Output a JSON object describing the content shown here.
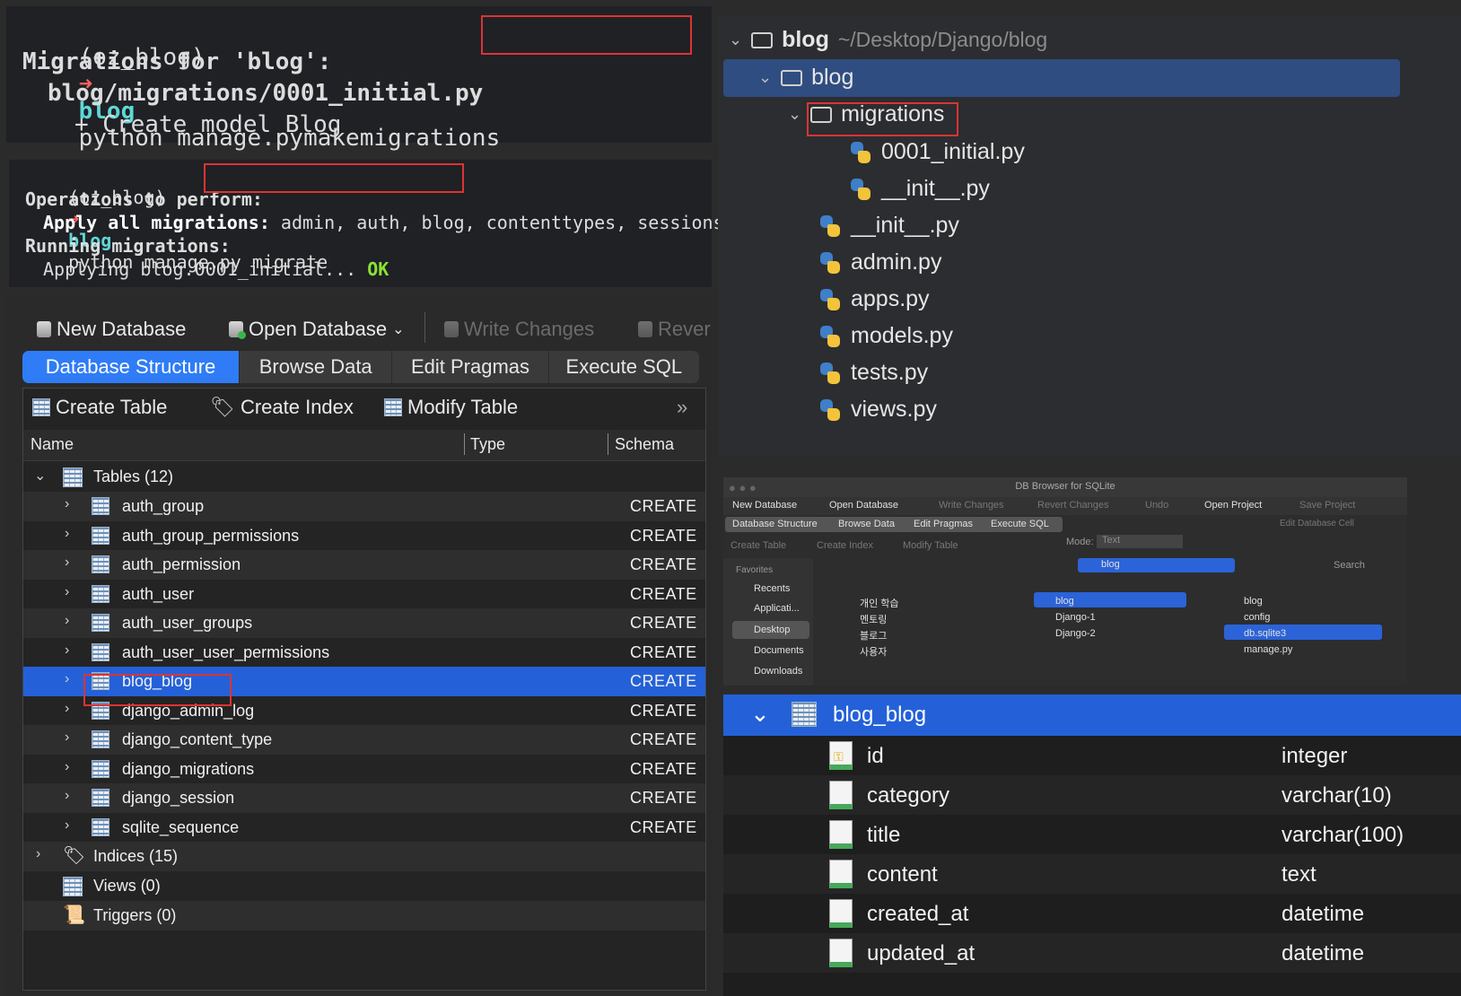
{
  "terminal1": {
    "line1_env": "(oz_blog)",
    "line1_arrow": "➜",
    "line1_dir": "blog",
    "line1_cmd": "python manage.py",
    "line1_sub": "makemigrations",
    "line2": "Migrations for 'blog':",
    "line3": "blog/migrations/0001_initial.py",
    "line4": "+ Create model Blog"
  },
  "terminal2": {
    "line1_env": "(oz_blog)",
    "line1_arrow": "➜",
    "line1_dir": "blog",
    "line1_cmd": "python manage.py migrate",
    "line2": "Operations to perform:",
    "line3_bold": "Apply all migrations:",
    "line3_rest": " admin, auth, blog, contenttypes, sessions",
    "line4": "Running migrations:",
    "line5": "Applying blog.0001_initial...",
    "line5_ok": "OK"
  },
  "toolbar": {
    "new_db": "New Database",
    "open_db": "Open Database",
    "write_changes": "Write Changes",
    "revert": "Rever"
  },
  "tabs": [
    "Database Structure",
    "Browse Data",
    "Edit Pragmas",
    "Execute SQL"
  ],
  "subtoolbar": {
    "create_table": "Create Table",
    "create_index": "Create Index",
    "modify_table": "Modify Table",
    "more": "»"
  },
  "columns": {
    "name": "Name",
    "type": "Type",
    "schema": "Schema"
  },
  "tables_header": "Tables (12)",
  "tables": [
    "auth_group",
    "auth_group_permissions",
    "auth_permission",
    "auth_user",
    "auth_user_groups",
    "auth_user_user_permissions",
    "blog_blog",
    "django_admin_log",
    "django_content_type",
    "django_migrations",
    "django_session",
    "sqlite_sequence"
  ],
  "schema_cell": "CREATE",
  "indices": "Indices (15)",
  "views": "Views (0)",
  "triggers": "Triggers (0)",
  "project": {
    "root_name": "blog",
    "root_path": "~/Desktop/Django/blog",
    "app": "blog",
    "migrations": "migrations",
    "migration_files": [
      "0001_initial.py",
      "__init__.py"
    ],
    "files": [
      "__init__.py",
      "admin.py",
      "apps.py",
      "models.py",
      "tests.py",
      "views.py"
    ]
  },
  "mini": {
    "title": "DB Browser for SQLite",
    "toolbar": [
      "New Database",
      "Open Database",
      "Write Changes",
      "Revert Changes",
      "Undo",
      "Open Project",
      "Save Project"
    ],
    "tabs": [
      "Database Structure",
      "Browse Data",
      "Edit Pragmas",
      "Execute SQL"
    ],
    "edit_cell": "Edit Database Cell",
    "subtoolbar": [
      "Create Table",
      "Create Index",
      "Modify Table"
    ],
    "mode_label": "Mode:",
    "mode_value": "Text",
    "favorites": "Favorites",
    "sidebar": [
      "Recents",
      "Applicati...",
      "Desktop",
      "Documents",
      "Downloads"
    ],
    "location": "blog",
    "search": "Search",
    "col1": [
      "개인 학습",
      "멘토링",
      "블로그",
      "사용자"
    ],
    "col2": [
      "blog",
      "Django-1",
      "Django-2"
    ],
    "col3": [
      "blog",
      "config",
      "db.sqlite3",
      "manage.py"
    ]
  },
  "blog_table": {
    "name": "blog_blog",
    "fields": [
      {
        "name": "id",
        "type": "integer"
      },
      {
        "name": "category",
        "type": "varchar(10)"
      },
      {
        "name": "title",
        "type": "varchar(100)"
      },
      {
        "name": "content",
        "type": "text"
      },
      {
        "name": "created_at",
        "type": "datetime"
      },
      {
        "name": "updated_at",
        "type": "datetime"
      }
    ]
  }
}
